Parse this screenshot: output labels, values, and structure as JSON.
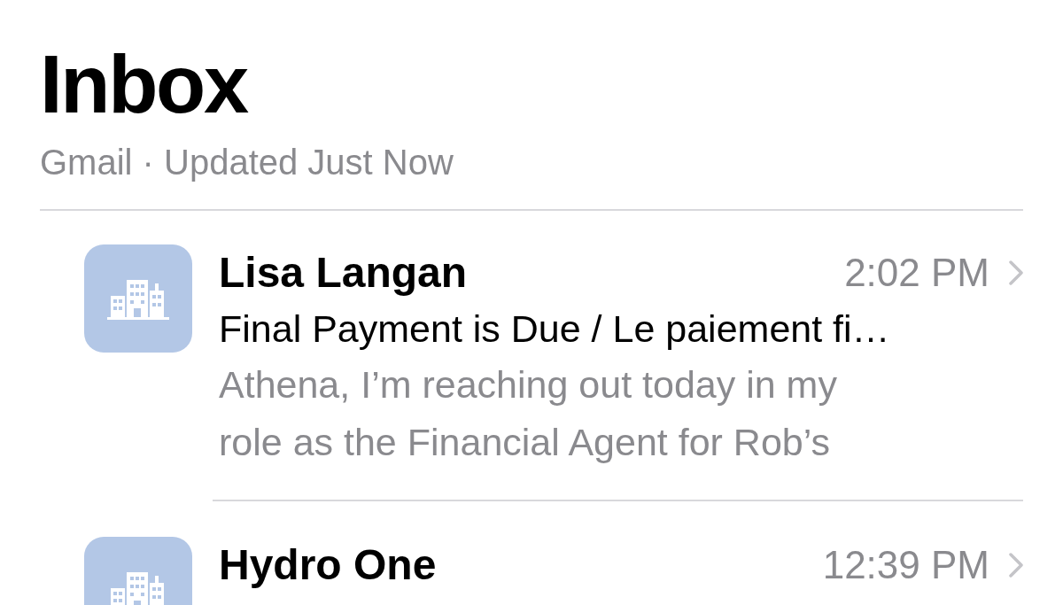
{
  "header": {
    "title": "Inbox",
    "subtitle": "Gmail · Updated Just Now"
  },
  "messages": [
    {
      "sender": "Lisa Langan",
      "time": "2:02 PM",
      "subject": "Final Payment is Due / Le paiement fi…",
      "preview": [
        "Athena, I’m reaching out today in my",
        "role as the Financial Agent for Rob’s"
      ]
    },
    {
      "sender": "Hydro One",
      "time": "12:39 PM"
    }
  ]
}
